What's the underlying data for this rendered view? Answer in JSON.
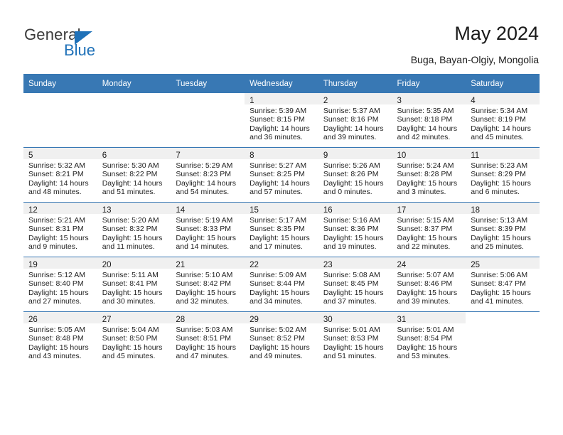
{
  "brand": {
    "name_top": "General",
    "name_bottom": "Blue",
    "accent_color": "#1f71b8"
  },
  "header": {
    "title": "May 2024",
    "subtitle": "Buga, Bayan-Olgiy, Mongolia"
  },
  "calendar": {
    "header_bg": "#3878b4",
    "date_band_bg": "#f0f0f0",
    "weekday_headers": [
      "Sunday",
      "Monday",
      "Tuesday",
      "Wednesday",
      "Thursday",
      "Friday",
      "Saturday"
    ],
    "weeks": [
      [
        {
          "date": "",
          "sunrise": "",
          "sunset": "",
          "daylight_line1": "",
          "daylight_line2": ""
        },
        {
          "date": "",
          "sunrise": "",
          "sunset": "",
          "daylight_line1": "",
          "daylight_line2": ""
        },
        {
          "date": "",
          "sunrise": "",
          "sunset": "",
          "daylight_line1": "",
          "daylight_line2": ""
        },
        {
          "date": "1",
          "sunrise": "Sunrise: 5:39 AM",
          "sunset": "Sunset: 8:15 PM",
          "daylight_line1": "Daylight: 14 hours",
          "daylight_line2": "and 36 minutes."
        },
        {
          "date": "2",
          "sunrise": "Sunrise: 5:37 AM",
          "sunset": "Sunset: 8:16 PM",
          "daylight_line1": "Daylight: 14 hours",
          "daylight_line2": "and 39 minutes."
        },
        {
          "date": "3",
          "sunrise": "Sunrise: 5:35 AM",
          "sunset": "Sunset: 8:18 PM",
          "daylight_line1": "Daylight: 14 hours",
          "daylight_line2": "and 42 minutes."
        },
        {
          "date": "4",
          "sunrise": "Sunrise: 5:34 AM",
          "sunset": "Sunset: 8:19 PM",
          "daylight_line1": "Daylight: 14 hours",
          "daylight_line2": "and 45 minutes."
        }
      ],
      [
        {
          "date": "5",
          "sunrise": "Sunrise: 5:32 AM",
          "sunset": "Sunset: 8:21 PM",
          "daylight_line1": "Daylight: 14 hours",
          "daylight_line2": "and 48 minutes."
        },
        {
          "date": "6",
          "sunrise": "Sunrise: 5:30 AM",
          "sunset": "Sunset: 8:22 PM",
          "daylight_line1": "Daylight: 14 hours",
          "daylight_line2": "and 51 minutes."
        },
        {
          "date": "7",
          "sunrise": "Sunrise: 5:29 AM",
          "sunset": "Sunset: 8:23 PM",
          "daylight_line1": "Daylight: 14 hours",
          "daylight_line2": "and 54 minutes."
        },
        {
          "date": "8",
          "sunrise": "Sunrise: 5:27 AM",
          "sunset": "Sunset: 8:25 PM",
          "daylight_line1": "Daylight: 14 hours",
          "daylight_line2": "and 57 minutes."
        },
        {
          "date": "9",
          "sunrise": "Sunrise: 5:26 AM",
          "sunset": "Sunset: 8:26 PM",
          "daylight_line1": "Daylight: 15 hours",
          "daylight_line2": "and 0 minutes."
        },
        {
          "date": "10",
          "sunrise": "Sunrise: 5:24 AM",
          "sunset": "Sunset: 8:28 PM",
          "daylight_line1": "Daylight: 15 hours",
          "daylight_line2": "and 3 minutes."
        },
        {
          "date": "11",
          "sunrise": "Sunrise: 5:23 AM",
          "sunset": "Sunset: 8:29 PM",
          "daylight_line1": "Daylight: 15 hours",
          "daylight_line2": "and 6 minutes."
        }
      ],
      [
        {
          "date": "12",
          "sunrise": "Sunrise: 5:21 AM",
          "sunset": "Sunset: 8:31 PM",
          "daylight_line1": "Daylight: 15 hours",
          "daylight_line2": "and 9 minutes."
        },
        {
          "date": "13",
          "sunrise": "Sunrise: 5:20 AM",
          "sunset": "Sunset: 8:32 PM",
          "daylight_line1": "Daylight: 15 hours",
          "daylight_line2": "and 11 minutes."
        },
        {
          "date": "14",
          "sunrise": "Sunrise: 5:19 AM",
          "sunset": "Sunset: 8:33 PM",
          "daylight_line1": "Daylight: 15 hours",
          "daylight_line2": "and 14 minutes."
        },
        {
          "date": "15",
          "sunrise": "Sunrise: 5:17 AM",
          "sunset": "Sunset: 8:35 PM",
          "daylight_line1": "Daylight: 15 hours",
          "daylight_line2": "and 17 minutes."
        },
        {
          "date": "16",
          "sunrise": "Sunrise: 5:16 AM",
          "sunset": "Sunset: 8:36 PM",
          "daylight_line1": "Daylight: 15 hours",
          "daylight_line2": "and 19 minutes."
        },
        {
          "date": "17",
          "sunrise": "Sunrise: 5:15 AM",
          "sunset": "Sunset: 8:37 PM",
          "daylight_line1": "Daylight: 15 hours",
          "daylight_line2": "and 22 minutes."
        },
        {
          "date": "18",
          "sunrise": "Sunrise: 5:13 AM",
          "sunset": "Sunset: 8:39 PM",
          "daylight_line1": "Daylight: 15 hours",
          "daylight_line2": "and 25 minutes."
        }
      ],
      [
        {
          "date": "19",
          "sunrise": "Sunrise: 5:12 AM",
          "sunset": "Sunset: 8:40 PM",
          "daylight_line1": "Daylight: 15 hours",
          "daylight_line2": "and 27 minutes."
        },
        {
          "date": "20",
          "sunrise": "Sunrise: 5:11 AM",
          "sunset": "Sunset: 8:41 PM",
          "daylight_line1": "Daylight: 15 hours",
          "daylight_line2": "and 30 minutes."
        },
        {
          "date": "21",
          "sunrise": "Sunrise: 5:10 AM",
          "sunset": "Sunset: 8:42 PM",
          "daylight_line1": "Daylight: 15 hours",
          "daylight_line2": "and 32 minutes."
        },
        {
          "date": "22",
          "sunrise": "Sunrise: 5:09 AM",
          "sunset": "Sunset: 8:44 PM",
          "daylight_line1": "Daylight: 15 hours",
          "daylight_line2": "and 34 minutes."
        },
        {
          "date": "23",
          "sunrise": "Sunrise: 5:08 AM",
          "sunset": "Sunset: 8:45 PM",
          "daylight_line1": "Daylight: 15 hours",
          "daylight_line2": "and 37 minutes."
        },
        {
          "date": "24",
          "sunrise": "Sunrise: 5:07 AM",
          "sunset": "Sunset: 8:46 PM",
          "daylight_line1": "Daylight: 15 hours",
          "daylight_line2": "and 39 minutes."
        },
        {
          "date": "25",
          "sunrise": "Sunrise: 5:06 AM",
          "sunset": "Sunset: 8:47 PM",
          "daylight_line1": "Daylight: 15 hours",
          "daylight_line2": "and 41 minutes."
        }
      ],
      [
        {
          "date": "26",
          "sunrise": "Sunrise: 5:05 AM",
          "sunset": "Sunset: 8:48 PM",
          "daylight_line1": "Daylight: 15 hours",
          "daylight_line2": "and 43 minutes."
        },
        {
          "date": "27",
          "sunrise": "Sunrise: 5:04 AM",
          "sunset": "Sunset: 8:50 PM",
          "daylight_line1": "Daylight: 15 hours",
          "daylight_line2": "and 45 minutes."
        },
        {
          "date": "28",
          "sunrise": "Sunrise: 5:03 AM",
          "sunset": "Sunset: 8:51 PM",
          "daylight_line1": "Daylight: 15 hours",
          "daylight_line2": "and 47 minutes."
        },
        {
          "date": "29",
          "sunrise": "Sunrise: 5:02 AM",
          "sunset": "Sunset: 8:52 PM",
          "daylight_line1": "Daylight: 15 hours",
          "daylight_line2": "and 49 minutes."
        },
        {
          "date": "30",
          "sunrise": "Sunrise: 5:01 AM",
          "sunset": "Sunset: 8:53 PM",
          "daylight_line1": "Daylight: 15 hours",
          "daylight_line2": "and 51 minutes."
        },
        {
          "date": "31",
          "sunrise": "Sunrise: 5:01 AM",
          "sunset": "Sunset: 8:54 PM",
          "daylight_line1": "Daylight: 15 hours",
          "daylight_line2": "and 53 minutes."
        },
        {
          "date": "",
          "sunrise": "",
          "sunset": "",
          "daylight_line1": "",
          "daylight_line2": ""
        }
      ]
    ]
  }
}
